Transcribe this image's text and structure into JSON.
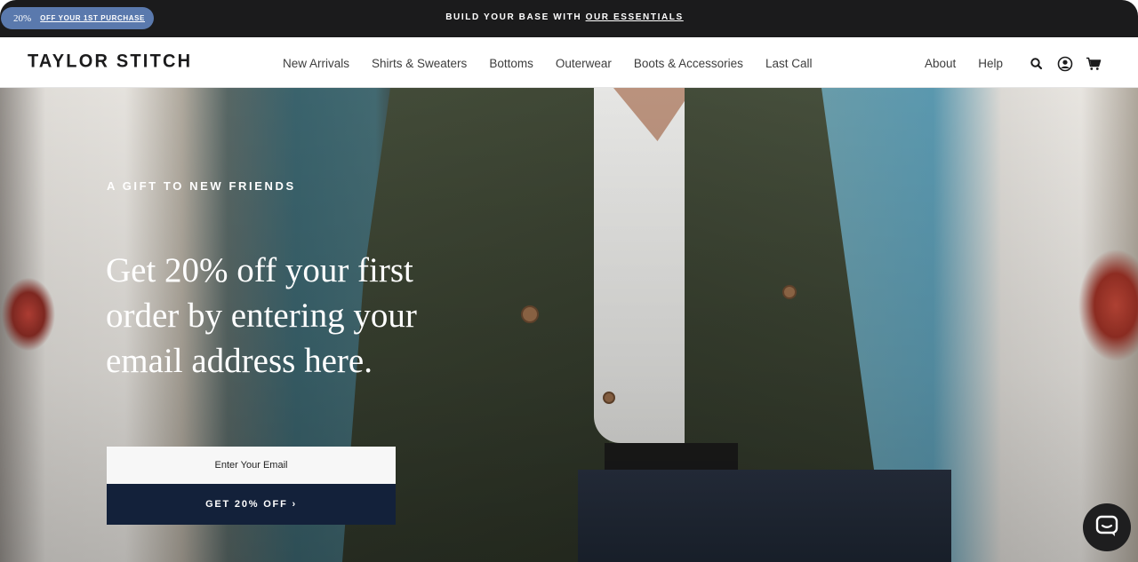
{
  "promo": {
    "pill_percent": "20%",
    "pill_text": "OFF YOUR 1ST PURCHASE",
    "announcement_prefix": "BUILD YOUR BASE WITH",
    "announcement_link": "OUR ESSENTIALS"
  },
  "header": {
    "logo": "TAYLOR STITCH",
    "nav": [
      "New Arrivals",
      "Shirts & Sweaters",
      "Bottoms",
      "Outerwear",
      "Boots & Accessories",
      "Last Call"
    ],
    "utility": [
      "About",
      "Help"
    ],
    "icons": [
      "search-icon",
      "account-icon",
      "cart-icon"
    ]
  },
  "hero": {
    "eyebrow": "A GIFT TO NEW FRIENDS",
    "headline": "Get 20% off your first order by entering your email address here.",
    "email_placeholder": "Enter Your Email",
    "cta_label": "GET 20% OFF ›"
  },
  "colors": {
    "promo_bar": "#1b1b1c",
    "promo_pill": "#5a79ad",
    "cta": "#13213a",
    "chat": "#1e1e1f"
  }
}
